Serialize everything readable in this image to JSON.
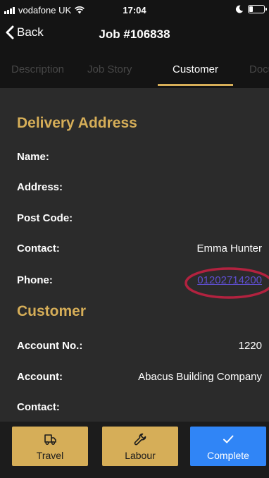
{
  "colors": {
    "accent": "#d6ae58",
    "link": "#5f4fd1",
    "primary": "#3085f6",
    "annotation": "#b2223f",
    "background": "#2b2b2b",
    "header": "#141414"
  },
  "status_bar": {
    "carrier": "vodafone UK",
    "time": "17:04",
    "icons": [
      "signal-icon",
      "wifi-icon",
      "moon-icon",
      "battery-icon"
    ]
  },
  "nav": {
    "back_label": "Back",
    "title": "Job #106838",
    "back_icon": "chevron-left-icon"
  },
  "tabs": [
    {
      "label": "Description",
      "active": false
    },
    {
      "label": "Job Story",
      "active": false
    },
    {
      "label": "Customer",
      "active": true
    },
    {
      "label": "Documents",
      "active": false
    }
  ],
  "delivery_address": {
    "title": "Delivery Address",
    "fields": [
      {
        "label": "Name:",
        "value": ""
      },
      {
        "label": "Address:",
        "value": ""
      },
      {
        "label": "Post Code:",
        "value": ""
      },
      {
        "label": "Contact:",
        "value": "Emma Hunter"
      },
      {
        "label": "Phone:",
        "value": "01202714200",
        "is_link": true
      }
    ]
  },
  "customer": {
    "title": "Customer",
    "fields": [
      {
        "label": "Account No.:",
        "value": "1220"
      },
      {
        "label": "Account:",
        "value": "Abacus Building Company"
      },
      {
        "label": "Contact:",
        "value": ""
      }
    ]
  },
  "actions": [
    {
      "label": "Travel",
      "icon": "van-icon"
    },
    {
      "label": "Labour",
      "icon": "wrench-icon"
    },
    {
      "label": "Complete",
      "icon": "checkmark-icon"
    }
  ]
}
